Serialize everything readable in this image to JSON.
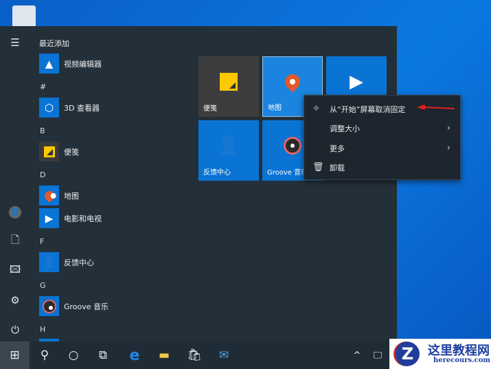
{
  "start_menu": {
    "recent_header": "最近添加",
    "apps": [
      {
        "label": "视频编辑器",
        "icon": "video-editor-icon"
      },
      {
        "label": "3D 查看器",
        "icon": "cube-icon"
      },
      {
        "label": "便笺",
        "icon": "sticky-note-icon"
      },
      {
        "label": "地图",
        "icon": "map-pin-icon"
      },
      {
        "label": "电影和电视",
        "icon": "movies-icon"
      },
      {
        "label": "反馈中心",
        "icon": "feedback-icon"
      },
      {
        "label": "Groove 音乐",
        "icon": "groove-icon"
      }
    ],
    "letters": [
      "#",
      "B",
      "D",
      "F",
      "G",
      "H"
    ],
    "tiles": [
      {
        "label": "便笺"
      },
      {
        "label": "地图"
      },
      {
        "label": ""
      },
      {
        "label": "反馈中心"
      },
      {
        "label": "Groove 音乐"
      }
    ]
  },
  "context_menu": {
    "items": [
      {
        "label": "从“开始”屏幕取消固定",
        "icon": "unpin-icon"
      },
      {
        "label": "调整大小",
        "submenu": true
      },
      {
        "label": "更多",
        "submenu": true
      },
      {
        "label": "卸载",
        "icon": "trash-icon"
      }
    ]
  },
  "watermark": {
    "title": "这里教程网",
    "url": "herecours.com"
  },
  "colors": {
    "accent": "#0a74d4",
    "menu_bg": "#23303a",
    "arrow": "#e02020"
  }
}
